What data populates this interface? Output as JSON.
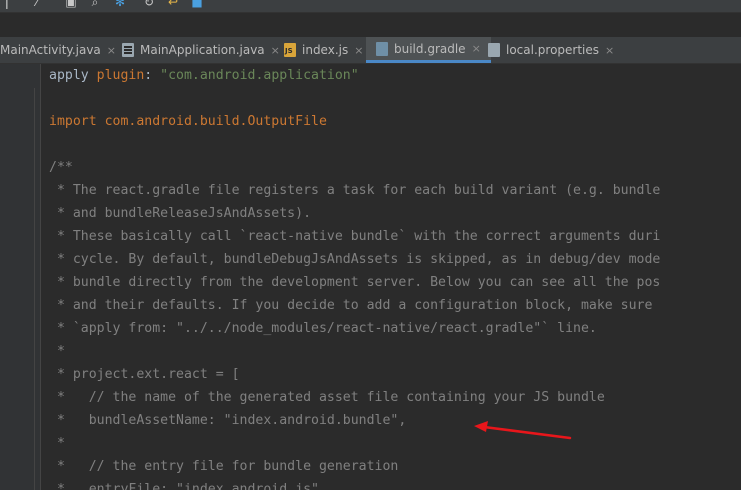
{
  "tabs": [
    {
      "label": "MainActivity.java",
      "icon": "java-file-icon",
      "active": false
    },
    {
      "label": "MainApplication.java",
      "icon": "java-file-icon",
      "active": false
    },
    {
      "label": "index.js",
      "icon": "js-file-icon",
      "active": false
    },
    {
      "label": "build.gradle",
      "icon": "gradle-file-icon",
      "active": true
    },
    {
      "label": "local.properties",
      "icon": "properties-file-icon",
      "active": false
    }
  ],
  "tab_close_glyph": "×",
  "code": {
    "l1": {
      "a": "apply ",
      "b": "plugin",
      "c": ": ",
      "d": "\"com.android.application\""
    },
    "l2": {
      "a": "import ",
      "b": "com.android.build.OutputFile"
    },
    "c1": "/**",
    "c2": " * The react.gradle file registers a task for each build variant (e.g. bundle",
    "c3": " * and bundleReleaseJsAndAssets).",
    "c4": " * These basically call `react-native bundle` with the correct arguments duri",
    "c5": " * cycle. By default, bundleDebugJsAndAssets is skipped, as in debug/dev mode",
    "c6": " * bundle directly from the development server. Below you can see all the pos",
    "c7": " * and their defaults. If you decide to add a configuration block, make sure",
    "c8": " * `apply from: \"../../node_modules/react-native/react.gradle\"` line.",
    "c9": " *",
    "c10": " * project.ext.react = [",
    "c11": " *   // the name of the generated asset file containing your JS bundle",
    "c12": " *   bundleAssetName: \"index.android.bundle\",",
    "c13": " *",
    "c14": " *   // the entry file for bundle generation",
    "c15": " *   entryFile: \"index.android.js\","
  },
  "colors": {
    "background": "#2b2b2b",
    "keyword": "#cc7832",
    "string": "#6a8759",
    "comment": "#808080",
    "annotation_arrow": "#e8161b"
  }
}
